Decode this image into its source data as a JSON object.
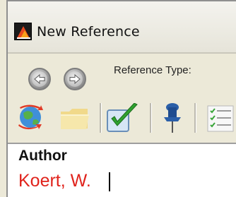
{
  "window": {
    "title": "New Reference",
    "app_icon": "endnote-app-icon"
  },
  "navigation": {
    "back_icon": "back-arrow-icon",
    "forward_icon": "forward-arrow-icon",
    "reference_type_label": "Reference Type:"
  },
  "toolbar": {
    "icons": [
      "globe-sync-icon",
      "folder-icon",
      "checkmark-icon",
      "pushpin-icon",
      "checklist-icon"
    ]
  },
  "fields": {
    "author": {
      "label": "Author",
      "value": "Koert, W."
    }
  },
  "colors": {
    "field_value_text": "#e0231c",
    "window_background": "#ece9d8",
    "field_panel_background": "#ffffff"
  }
}
